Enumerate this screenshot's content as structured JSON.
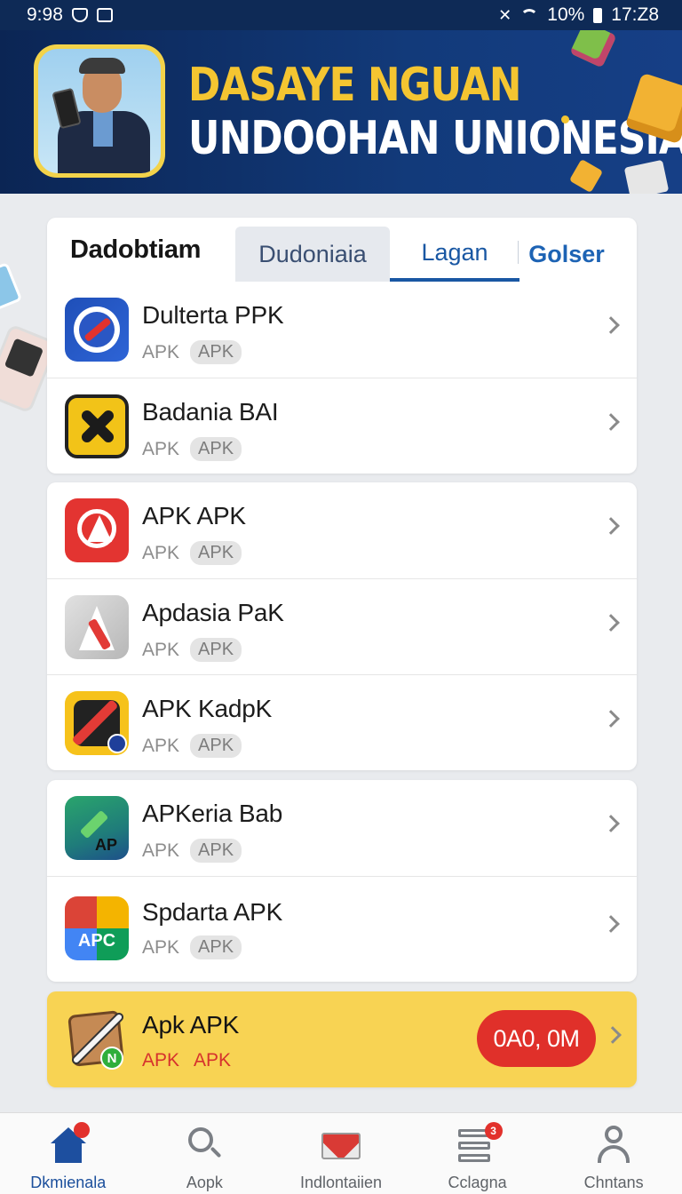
{
  "status_bar": {
    "time": "9:98",
    "battery": "10%",
    "clock_right": "17:Z8",
    "icons": [
      "shield-icon",
      "notification-icon",
      "mute-icon",
      "wifi-icon",
      "battery-icon"
    ]
  },
  "banner": {
    "line1": "DASAYE NGUAN",
    "line2": "UNDOOHAN UNIONESIA",
    "colors": {
      "line1": "#f4c531",
      "line2": "#ffffff",
      "background": "#0b2554"
    }
  },
  "tabs": {
    "title": "Dadobtiam",
    "items": [
      "Dudoniaia",
      "Lagan",
      "Golser"
    ],
    "active": "Lagan"
  },
  "apps_group1": [
    {
      "name": "Dulterta PPK",
      "type": "APK",
      "badge": "APK",
      "icon": "compass-icon"
    },
    {
      "name": "Badania BAI",
      "type": "APK",
      "badge": "APK",
      "icon": "x-icon"
    }
  ],
  "apps_group2": [
    {
      "name": "APK APK",
      "type": "APK",
      "badge": "APK",
      "icon": "anarchy-icon"
    },
    {
      "name": "Apdasia PaK",
      "type": "APK",
      "badge": "APK",
      "icon": "letter-a-icon"
    },
    {
      "name": "APK KadpK",
      "type": "APK",
      "badge": "APK",
      "icon": "pen-icon"
    }
  ],
  "apps_group3": [
    {
      "name": "APKeria Bab",
      "type": "APK",
      "badge": "APK",
      "icon": "check-icon",
      "icon_text": "AP"
    },
    {
      "name": "Spdarta APK",
      "type": "APK",
      "badge": "APK",
      "icon": "multicolor-icon",
      "icon_text": "APC"
    }
  ],
  "promo": {
    "name": "Apk APK",
    "type": "APK",
    "badge": "APK",
    "icon_badge": "N",
    "button": "0A0, 0M",
    "colors": {
      "background": "#f8d353",
      "button": "#e0302a"
    }
  },
  "bottom_nav": {
    "items": [
      {
        "label": "Dkmienala",
        "icon": "home-icon"
      },
      {
        "label": "Aopk",
        "icon": "search-icon"
      },
      {
        "label": "Indlontaiien",
        "icon": "mail-icon"
      },
      {
        "label": "Cclagna",
        "icon": "list-icon",
        "badge": "3"
      },
      {
        "label": "Chntans",
        "icon": "user-icon"
      }
    ],
    "active": "Dkmienala"
  }
}
